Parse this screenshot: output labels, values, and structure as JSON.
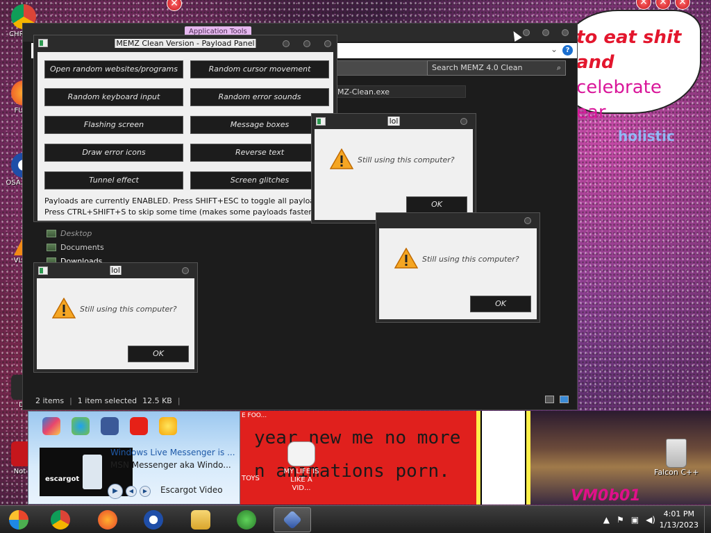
{
  "desktop": {
    "icons_left": [
      {
        "label": "CHR DIS"
      },
      {
        "label": "FURR"
      },
      {
        "label": "OSA LADE"
      },
      {
        "label": "VLC P"
      },
      {
        "label": "Do"
      },
      {
        "label": "Not D"
      }
    ],
    "bubble": {
      "line1": "to eat shit",
      "line2_bold": "and",
      "line2_plain": "celebrate",
      "line3": "ear"
    },
    "holistic": "holistic",
    "recycle_bin": "Falcon C++",
    "toys_label": "TOYS",
    "toy_icon": "MY LIFE IS LIKE A VID...",
    "banner_small": "E FOO...",
    "banner_line1": "year new me no more",
    "banner_line2": "n animations porn.",
    "photo_text": "VM0b01"
  },
  "explorer": {
    "app_tools": "Application Tools",
    "search_placeholder": "Search MEMZ 4.0 Clean",
    "file_name": "MZ-Clean.exe",
    "nav": [
      {
        "label": "Desktop"
      },
      {
        "label": "Documents"
      },
      {
        "label": "Downloads"
      }
    ],
    "status_items": "2 items",
    "status_selected": "1 item selected",
    "status_size": "12.5 KB"
  },
  "payload_panel": {
    "title": "MEMZ Clean Version - Payload Panel",
    "buttons": [
      "Open random websites/programs",
      "Random cursor movement",
      "Random keyboard input",
      "Random error sounds",
      "Flashing screen",
      "Message boxes",
      "Draw error icons",
      "Reverse text",
      "Tunnel effect",
      "Screen glitches"
    ],
    "note1": "Payloads are currently ENABLED. Press SHIFT+ESC to toggle all payloads!",
    "note2": "Press CTRL+SHIFT+S to skip some time (makes some payloads faster)"
  },
  "dialogs": [
    {
      "title": "lol",
      "message": "Still using this computer?",
      "ok": "OK"
    },
    {
      "title": "lol",
      "message": "Still using this computer?",
      "ok": "OK"
    },
    {
      "title": "lol",
      "message": "Still using this computer?",
      "ok": "OK"
    }
  ],
  "msn": {
    "title": "Windows Live Messenger is ...",
    "subtitle": "MSN Messenger aka Windo...",
    "thumb_label": "escargot",
    "video_label": "Escargot Video"
  },
  "taskbar": {
    "time": "4:01 PM",
    "date": "1/13/2023"
  },
  "colors": {
    "accent_red": "#e3162d",
    "panel_dark": "#1c1c1c",
    "dialog_bg": "#f0f0f0"
  }
}
